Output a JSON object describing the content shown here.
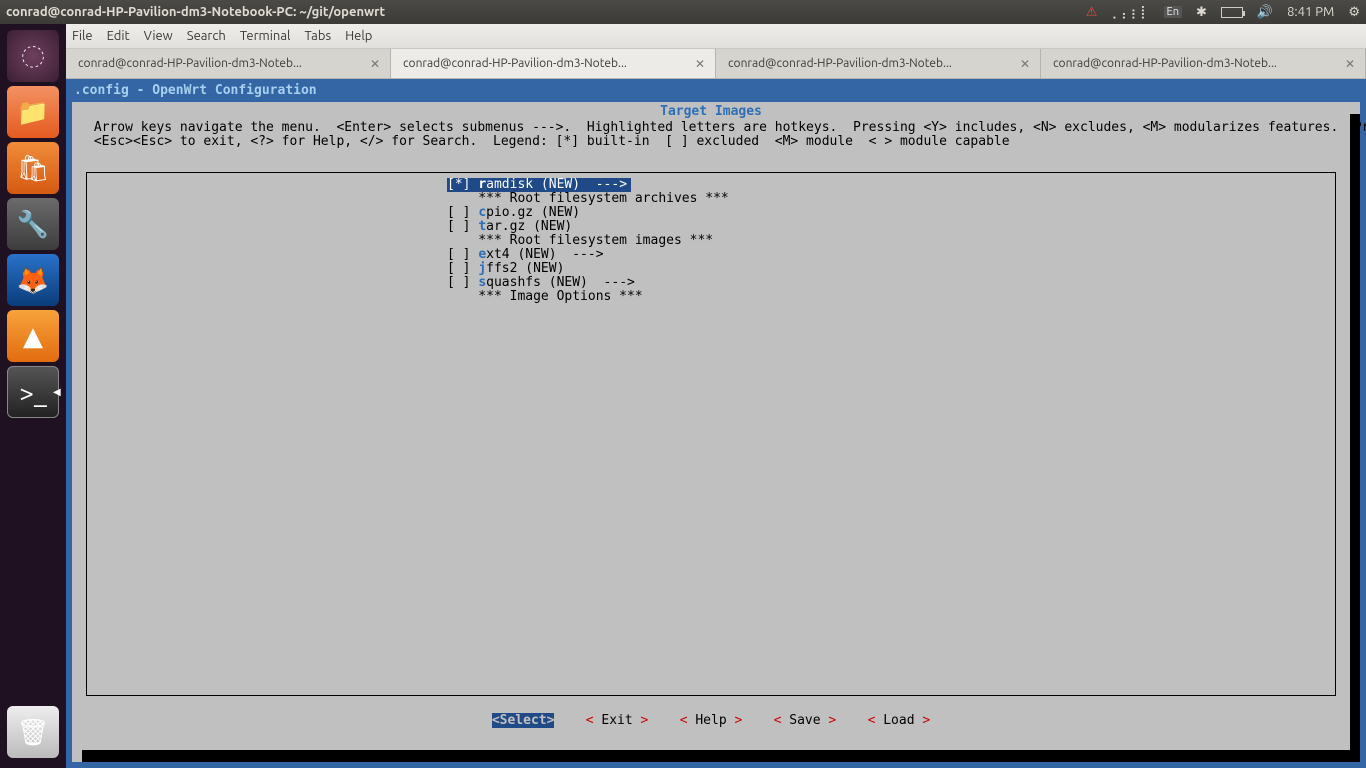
{
  "topbar": {
    "title": "conrad@conrad-HP-Pavilion-dm3-Notebook-PC: ~/git/openwrt",
    "lang": "En",
    "time": "8:41 PM"
  },
  "menubar": [
    "File",
    "Edit",
    "View",
    "Search",
    "Terminal",
    "Tabs",
    "Help"
  ],
  "tabs": [
    {
      "label": "conrad@conrad-HP-Pavilion-dm3-Noteb...",
      "active": false
    },
    {
      "label": "conrad@conrad-HP-Pavilion-dm3-Noteb...",
      "active": true
    },
    {
      "label": "conrad@conrad-HP-Pavilion-dm3-Noteb...",
      "active": false
    },
    {
      "label": "conrad@conrad-HP-Pavilion-dm3-Noteb...",
      "active": false
    }
  ],
  "term_title": ".config - OpenWrt Configuration",
  "section_title": "Target Images",
  "help_line1": " Arrow keys navigate the menu.  <Enter> selects submenus --->.  Highlighted letters are hotkeys.  Pressing <Y> includes, <N> excludes, <M> modularizes features.  Press",
  "help_line2": " <Esc><Esc> to exit, <?> for Help, </> for Search.  Legend: [*] built-in  [ ] excluded  <M> module  < > module capable",
  "menu_items": [
    {
      "bracket": "[*]",
      "hot": "r",
      "rest": "amdisk (NEW)  --->",
      "selected": true
    },
    {
      "bracket": "   ",
      "hot": "",
      "rest": "*** Root filesystem archives ***",
      "selected": false,
      "comment": true
    },
    {
      "bracket": "[ ]",
      "hot": "c",
      "rest": "pio.gz (NEW)",
      "selected": false
    },
    {
      "bracket": "[ ]",
      "hot": "t",
      "rest": "ar.gz (NEW)",
      "selected": false
    },
    {
      "bracket": "   ",
      "hot": "",
      "rest": "*** Root filesystem images ***",
      "selected": false,
      "comment": true
    },
    {
      "bracket": "[ ]",
      "hot": "e",
      "rest": "xt4 (NEW)  --->",
      "selected": false
    },
    {
      "bracket": "[ ]",
      "hot": "j",
      "rest": "ffs2 (NEW)",
      "selected": false
    },
    {
      "bracket": "[ ]",
      "hot": "s",
      "rest": "quashfs (NEW)  --->",
      "selected": false
    },
    {
      "bracket": "   ",
      "hot": "",
      "rest": "*** Image Options ***",
      "selected": false,
      "comment": true
    }
  ],
  "buttons": {
    "select": "Select",
    "exit": "Exit",
    "help": "Help",
    "save": "Save",
    "load": "Load"
  }
}
